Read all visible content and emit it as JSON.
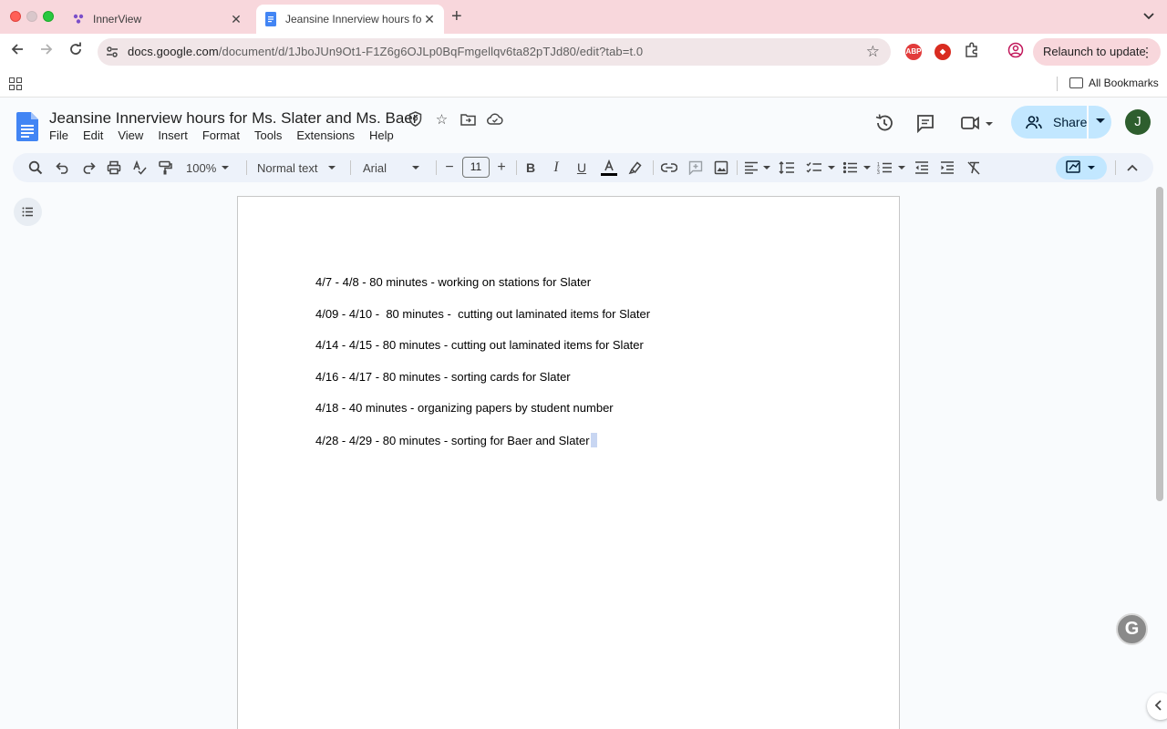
{
  "browser": {
    "tabs": [
      {
        "title": "InnerView",
        "active": false
      },
      {
        "title": "Jeansine Innerview hours for Ms. Slater and Ms. Baer",
        "active": true
      }
    ],
    "url_domain": "docs.google.com",
    "url_path": "/document/d/1JboJUn9Ot1-F1Z6g6OJLp0BqFmgellqv6ta82pTJd80/edit?tab=t.0",
    "relaunch_label": "Relaunch to update",
    "all_bookmarks_label": "All Bookmarks"
  },
  "docs": {
    "title": "Jeansine Innerview hours for Ms. Slater and Ms. Baer",
    "menus": [
      "File",
      "Edit",
      "View",
      "Insert",
      "Format",
      "Tools",
      "Extensions",
      "Help"
    ],
    "share_label": "Share",
    "avatar_initial": "J"
  },
  "toolbar": {
    "zoom": "100%",
    "style": "Normal text",
    "font": "Arial",
    "font_size": "11"
  },
  "document": {
    "paragraphs": [
      "4/7 - 4/8 - 80 minutes - working on stations for Slater",
      "4/09 - 4/10 -  80 minutes -  cutting out laminated items for Slater",
      "4/14 - 4/15 - 80 minutes - cutting out laminated items for Slater",
      "4/16 - 4/17 - 80 minutes - sorting cards for Slater",
      "4/18 - 40 minutes - organizing papers by student number",
      "4/28 - 4/29 - 80 minutes - sorting for Baer and Slater"
    ]
  },
  "colors": {
    "tab_strip": "#f8d7dc",
    "share_button": "#c2e7ff",
    "docs_blue": "#4285f4",
    "avatar_bg": "#2e5e2e"
  }
}
